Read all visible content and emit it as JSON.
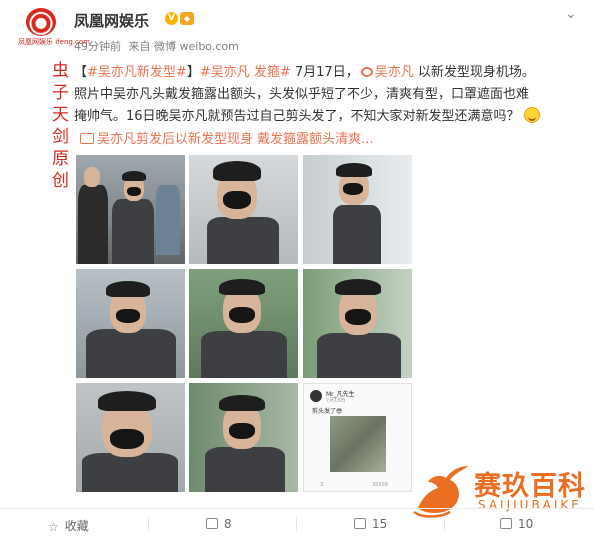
{
  "header": {
    "author_name": "凤凰网娱乐",
    "avatar_caption": "凤凰网娱乐 ifeng.com",
    "time": "49分钟前",
    "source": "来自 微博 weibo.com",
    "verified_badge": "V"
  },
  "post": {
    "tag_open": "【",
    "topic1": "#吴亦凡新发型#",
    "tag_close": "】",
    "topic2": "#吴亦凡 发箍#",
    "date": " 7月17日，",
    "mention": "吴亦凡",
    "line1_tail": " 以新发型现身机场。",
    "line2": "照片中吴亦凡头戴发箍露出额头，头发似乎短了不少，清爽有型，口罩遮面也难",
    "line3": "掩帅气。16日晚吴亦凡就预告过自己剪头发了，不知大家对新发型还满意吗？",
    "video_link": "吴亦凡剪发后以新发型现身 戴发箍露额头清爽..."
  },
  "watermark": {
    "left_text": "虫子天剑原创",
    "brand_cn": "赛玖百科",
    "brand_en": "SAIJIUBAIKE"
  },
  "embedded_card": {
    "user": "Mr_凡先生",
    "time": "7月16日",
    "text": "剪头发了😎",
    "footer_like": "3",
    "footer_count": "35509"
  },
  "actions": {
    "favorite": "收藏",
    "repost": "8",
    "comment": "15",
    "like": "10"
  },
  "colors": {
    "accent": "#eb7350",
    "brand": "#ea6f22",
    "watermark_red": "#d42a20"
  }
}
